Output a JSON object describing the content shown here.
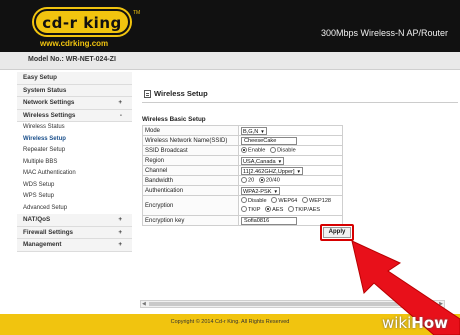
{
  "brand": {
    "logo": "cd-r king",
    "trademark": "TM",
    "url": "www.cdrking.com",
    "product_title": "300Mbps Wireless-N AP/Router"
  },
  "model_bar": {
    "label": "Model No.: WR-NET-024-ZI"
  },
  "sidebar": {
    "top_items": [
      {
        "label": "Easy Setup"
      },
      {
        "label": "System Status"
      },
      {
        "label": "Network Settings",
        "toggle": "+"
      },
      {
        "label": "Wireless Settings",
        "toggle": "-"
      }
    ],
    "sub_items": [
      {
        "label": "Wireless Status"
      },
      {
        "label": "Wireless Setup"
      },
      {
        "label": "Repeater Setup"
      },
      {
        "label": "Multiple BBS"
      },
      {
        "label": "MAC Authentication"
      },
      {
        "label": "WDS Setup"
      },
      {
        "label": "WPS Setup"
      },
      {
        "label": "Advanced Setup"
      }
    ],
    "bottom_items": [
      {
        "label": "NAT/QoS",
        "toggle": "+"
      },
      {
        "label": "Firewall Settings",
        "toggle": "+"
      },
      {
        "label": "Management",
        "toggle": "+"
      }
    ]
  },
  "main": {
    "title": "Wireless Setup",
    "group_title": "Wireless Basic Setup",
    "fields": {
      "mode": {
        "label": "Mode",
        "value": "B,G,N"
      },
      "ssid": {
        "label": "Wireless Network Name(SSID)",
        "value": "CheeseCake"
      },
      "ssid_broadcast": {
        "label": "SSID Broadcast",
        "enable": "Enable",
        "disable": "Disable"
      },
      "region": {
        "label": "Region",
        "value": "USA,Canada"
      },
      "channel": {
        "label": "Channel",
        "value": "11[2.462GHZ,Upper]"
      },
      "bandwidth": {
        "label": "Bandwidth",
        "opt1": "20",
        "opt2": "20/40"
      },
      "authentication": {
        "label": "Authentication",
        "value": "WPA2-PSK"
      },
      "encryption": {
        "label": "Encryption",
        "opt_disable": "Disable",
        "opt_wep64": "WEP64",
        "opt_wep128": "WEP128",
        "opt_tkip": "TKIP",
        "opt_aes": "AES",
        "opt_tkipaes": "TKIP/AES"
      },
      "encryption_key": {
        "label": "Encryption key",
        "value": "Sofia0816"
      }
    },
    "apply_label": "Apply"
  },
  "footer": {
    "text": "Copyright © 2014 Cd-r King. All Rights Reserved"
  },
  "watermark": {
    "part1": "wiki",
    "part2": "How"
  },
  "colors": {
    "header": "#111111",
    "brand_yellow": "#f1c40f",
    "highlight_red": "#d60000",
    "arrow_red": "#e8101a"
  }
}
